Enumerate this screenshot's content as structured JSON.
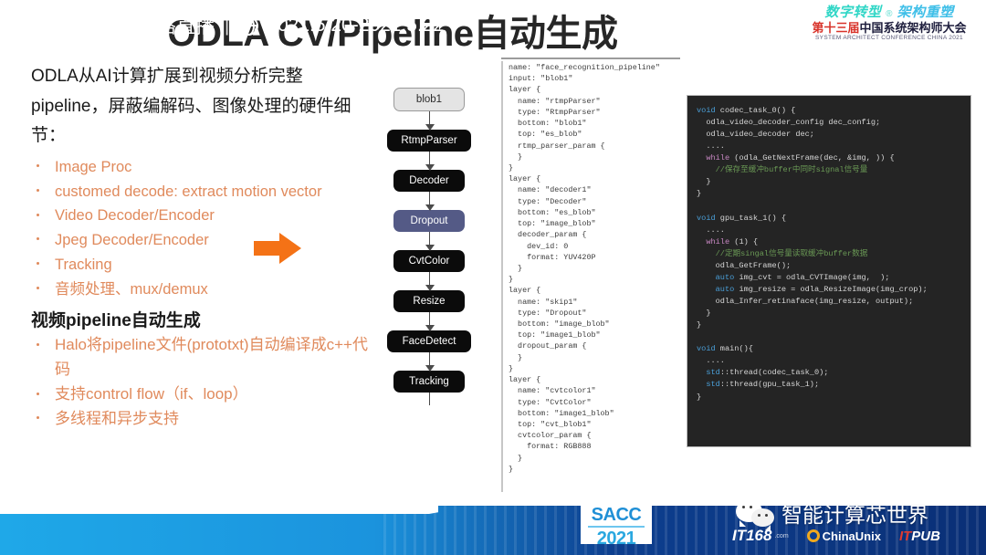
{
  "slide": {
    "title": "ODLA CV/Pipeline自动生成"
  },
  "conference_logo": {
    "line1_a": "数字转型",
    "line1_reg": "®",
    "line1_b": "架构重塑",
    "line2_prefix": "第十三届",
    "line2_main": "中国系统架构师大会",
    "line3": "SYSTEM ARCHITECT CONFERENCE CHINA 2021"
  },
  "left_column": {
    "lead_paragraph": "ODLA从AI计算扩展到视频分析完整pipeline，屏蔽编解码、图像处理的硬件细节：",
    "bullets": [
      "Image Proc",
      "customed decode: extract motion vector",
      "Video Decoder/Encoder",
      "Jpeg Decoder/Encoder",
      "Tracking",
      "音频处理、mux/demux"
    ],
    "sub_heading": "视频pipeline自动生成",
    "sub_bullets": [
      "Halo将pipeline文件(prototxt)自动编译成c++代码",
      "支持control flow（if、loop）",
      "多线程和异步支持"
    ]
  },
  "flowchart": {
    "nodes": [
      {
        "label": "blob1",
        "style": "start"
      },
      {
        "label": "RtmpParser",
        "style": "dark"
      },
      {
        "label": "Decoder",
        "style": "dark"
      },
      {
        "label": "Dropout",
        "style": "accent"
      },
      {
        "label": "CvtColor",
        "style": "dark"
      },
      {
        "label": "Resize",
        "style": "dark"
      },
      {
        "label": "FaceDetect",
        "style": "dark"
      },
      {
        "label": "Tracking",
        "style": "dark"
      }
    ]
  },
  "arrows": {
    "color": "#f47216",
    "arrow_1_name": "flow-to-prototxt-arrow",
    "arrow_2_name": "prototxt-to-code-arrow"
  },
  "prototxt_panel": {
    "content": "name: \"face_recognition_pipeline\"\ninput: \"blob1\"\nlayer {\n  name: \"rtmpParser\"\n  type: \"RtmpParser\"\n  bottom: \"blob1\"\n  top: \"es_blob\"\n  rtmp_parser_param {\n  }\n}\nlayer {\n  name: \"decoder1\"\n  type: \"Decoder\"\n  bottom: \"es_blob\"\n  top: \"image_blob\"\n  decoder_param {\n    dev_id: 0\n    format: YUV420P\n  }\n}\nlayer {\n  name: \"skip1\"\n  type: \"Dropout\"\n  bottom: \"image_blob\"\n  top: \"image1_blob\"\n  dropout_param {\n  }\n}\nlayer {\n  name: \"cvtcolor1\"\n  type: \"CvtColor\"\n  bottom: \"image1_blob\"\n  top: \"cvt_blob1\"\n  cvtcolor_param {\n    format: RGB888\n  }\n}"
  },
  "code_panel": {
    "background": "#242424",
    "lines": [
      {
        "indent": 0,
        "tokens": [
          {
            "t": "void ",
            "c": "ty"
          },
          {
            "t": "codec_task_0() {",
            "c": "fn"
          }
        ]
      },
      {
        "indent": 1,
        "tokens": [
          {
            "t": "odla_video_decoder_config dec_config;",
            "c": "fn"
          }
        ]
      },
      {
        "indent": 1,
        "tokens": [
          {
            "t": "odla_video_decoder dec;",
            "c": "fn"
          }
        ]
      },
      {
        "indent": 1,
        "tokens": [
          {
            "t": "....",
            "c": "fn"
          }
        ]
      },
      {
        "indent": 1,
        "tokens": [
          {
            "t": "while ",
            "c": "kw"
          },
          {
            "t": "(odla_GetNextFrame(dec, &img, )) {",
            "c": "fn"
          }
        ]
      },
      {
        "indent": 2,
        "tokens": [
          {
            "t": "//保存至缓冲buffer中同时signal信号量",
            "c": "cm"
          }
        ]
      },
      {
        "indent": 1,
        "tokens": [
          {
            "t": "}",
            "c": "fn"
          }
        ]
      },
      {
        "indent": 0,
        "tokens": [
          {
            "t": "}",
            "c": "fn"
          }
        ]
      },
      {
        "indent": 0,
        "tokens": [
          {
            "t": "",
            "c": "fn"
          }
        ]
      },
      {
        "indent": 0,
        "tokens": [
          {
            "t": "void ",
            "c": "ty"
          },
          {
            "t": "gpu_task_1() {",
            "c": "fn"
          }
        ]
      },
      {
        "indent": 1,
        "tokens": [
          {
            "t": "....",
            "c": "fn"
          }
        ]
      },
      {
        "indent": 1,
        "tokens": [
          {
            "t": "while ",
            "c": "kw"
          },
          {
            "t": "(1) {",
            "c": "fn"
          }
        ]
      },
      {
        "indent": 2,
        "tokens": [
          {
            "t": "//定期singal信号量读取缓冲buffer数据",
            "c": "cm"
          }
        ]
      },
      {
        "indent": 2,
        "tokens": [
          {
            "t": "odla_GetFrame();",
            "c": "fn"
          }
        ]
      },
      {
        "indent": 2,
        "tokens": [
          {
            "t": "auto ",
            "c": "ty"
          },
          {
            "t": "img_cvt = odla_CVTImage(img,  );",
            "c": "fn"
          }
        ]
      },
      {
        "indent": 2,
        "tokens": [
          {
            "t": "auto ",
            "c": "ty"
          },
          {
            "t": "img_resize = odla_ResizeImage(img_crop);",
            "c": "fn"
          }
        ]
      },
      {
        "indent": 2,
        "tokens": [
          {
            "t": "odla_Infer_retinaface(img_resize, output);",
            "c": "fn"
          }
        ]
      },
      {
        "indent": 1,
        "tokens": [
          {
            "t": "}",
            "c": "fn"
          }
        ]
      },
      {
        "indent": 0,
        "tokens": [
          {
            "t": "}",
            "c": "fn"
          }
        ]
      },
      {
        "indent": 0,
        "tokens": [
          {
            "t": "",
            "c": "fn"
          }
        ]
      },
      {
        "indent": 0,
        "tokens": [
          {
            "t": "void ",
            "c": "ty"
          },
          {
            "t": "main(){",
            "c": "fn"
          }
        ]
      },
      {
        "indent": 1,
        "tokens": [
          {
            "t": "....",
            "c": "fn"
          }
        ]
      },
      {
        "indent": 1,
        "tokens": [
          {
            "t": "std",
            "c": "ty"
          },
          {
            "t": "::thread(codec_task_0);",
            "c": "fn"
          }
        ]
      },
      {
        "indent": 1,
        "tokens": [
          {
            "t": "std",
            "c": "ty"
          },
          {
            "t": "::thread(gpu_task_1);",
            "c": "fn"
          }
        ]
      },
      {
        "indent": 0,
        "tokens": [
          {
            "t": "}",
            "c": "fn"
          }
        ]
      }
    ]
  },
  "footer": {
    "live_label": "云上会议 网络直播",
    "separator": "|",
    "dates": "2021.5.20-2021.5.22",
    "sacc": {
      "name": "SACC",
      "year": "2021"
    },
    "wechat_brand": "智能计算芯世界",
    "partners": {
      "it168": "IT168",
      "it168_suffix": ".com",
      "chinaunix": "ChinaUnix",
      "itpub_a": "IT",
      "itpub_b": "PUB"
    }
  }
}
